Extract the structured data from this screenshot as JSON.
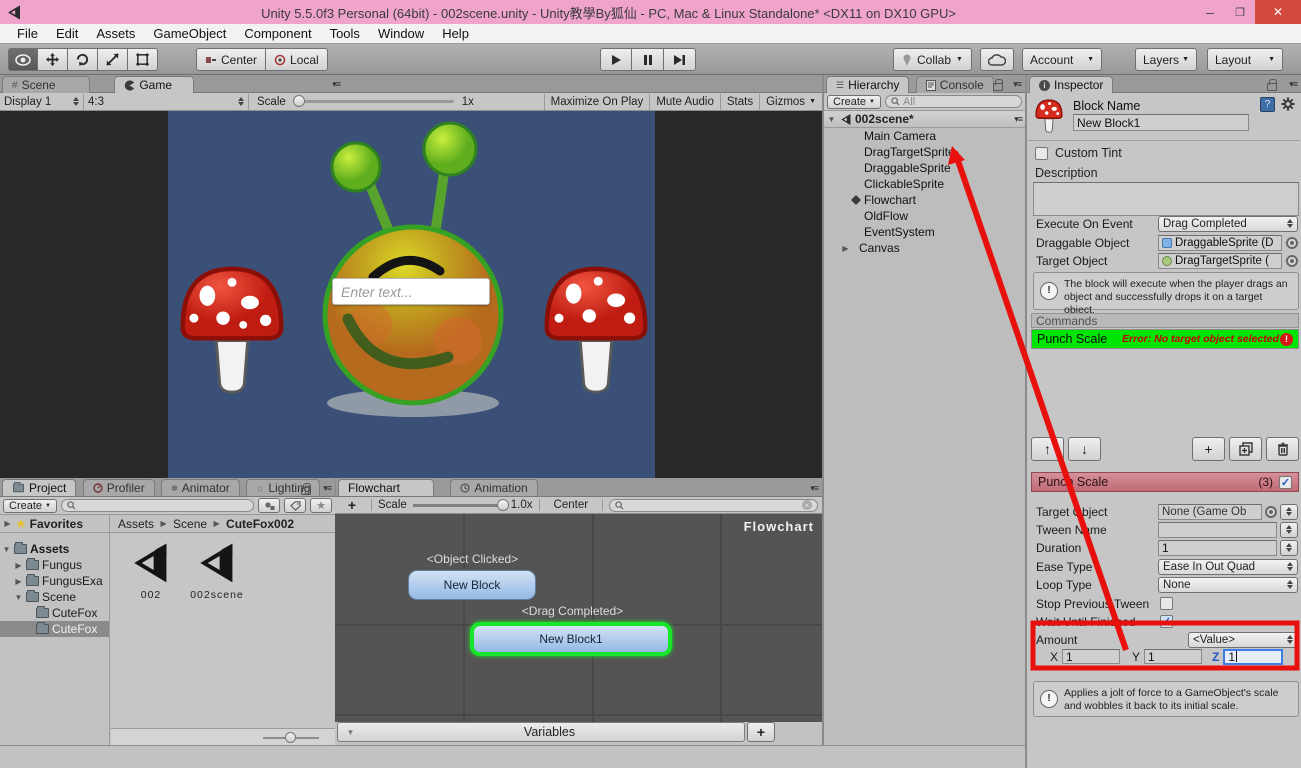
{
  "window": {
    "title": "Unity 5.5.0f3 Personal (64bit) - 002scene.unity - Unity教學By狐仙 - PC, Mac & Linux Standalone* <DX11 on DX10 GPU>",
    "minimize": "–",
    "restore": "❐",
    "close": "✕"
  },
  "menu": {
    "items": [
      "File",
      "Edit",
      "Assets",
      "GameObject",
      "Component",
      "Tools",
      "Window",
      "Help"
    ]
  },
  "toolbar": {
    "center_label": "Center",
    "local_label": "Local",
    "collab_label": "Collab",
    "account_label": "Account",
    "layers_label": "Layers",
    "layout_label": "Layout"
  },
  "game": {
    "scene_tab": "Scene",
    "game_tab": "Game",
    "display": "Display 1",
    "aspect": "4:3",
    "scale_label": "Scale",
    "scale_value": "1x",
    "maximize_label": "Maximize On Play",
    "mute_label": "Mute Audio",
    "stats_label": "Stats",
    "gizmos_label": "Gizmos",
    "input_placeholder": "Enter text...",
    "bg_color": "#3a5076"
  },
  "hierarchy": {
    "tab_label": "Hierarchy",
    "console_label": "Console",
    "create_label": "Create",
    "search_scope": "All",
    "scene_label": "002scene*",
    "items": [
      "Main Camera",
      "DragTargetSprite",
      "DraggableSprite",
      "ClickableSprite",
      "Flowchart",
      "OldFlow",
      "EventSystem",
      "Canvas"
    ]
  },
  "inspector": {
    "tab_label": "Inspector",
    "block_name_label": "Block Name",
    "block_name_value": "New Block1",
    "custom_tint_label": "Custom Tint",
    "custom_tint_checked": false,
    "description_label": "Description",
    "description_value": "",
    "execute_label": "Execute On Event",
    "execute_value": "Drag Completed",
    "draggable_label": "Draggable Object",
    "draggable_value": "DraggableSprite (D",
    "target_label": "Target Object",
    "target_value": "DragTargetSprite (",
    "event_info": "The block will execute when the player drags an object and successfully drops it on a target object."
  },
  "commands": {
    "header": "Commands",
    "name": "Punch Scale",
    "error": "Error: No target object selected",
    "row_color": "#00e504"
  },
  "punch": {
    "title": "Punch Scale",
    "count": "(3)",
    "enabled": true,
    "target_label": "Target Object",
    "target_value": "None (Game Ob",
    "tween_label": "Tween Name",
    "tween_value": "",
    "duration_label": "Duration",
    "duration_value": "1",
    "ease_label": "Ease Type",
    "ease_value": "Ease In Out Quad",
    "loop_label": "Loop Type",
    "loop_value": "None",
    "stop_label": "Stop Previous Tween",
    "stop_checked": false,
    "wait_label": "Wait Until Finished",
    "wait_checked": true,
    "amount_label": "Amount",
    "amount_value": "<Value>",
    "x_label": "X",
    "x_value": "1",
    "y_label": "Y",
    "y_value": "1",
    "z_label": "Z",
    "z_value": "1",
    "info": "Applies a jolt of force to a GameObject's scale and wobbles it back to its initial scale."
  },
  "project": {
    "tab_label": "Project",
    "profiler_label": "Profiler",
    "animator_label": "Animator",
    "lighting_label": "Lighting",
    "create_label": "Create",
    "favorites_label": "Favorites",
    "breadcrumb": [
      "Assets",
      "Scene",
      "CuteFox002"
    ],
    "tree": [
      "Assets",
      "Fungus",
      "FungusExa",
      "Scene",
      "CuteFox",
      "CuteFox"
    ],
    "assets": [
      "002",
      "002scene"
    ]
  },
  "flowchart": {
    "tab_label": "Flowchart",
    "animation_label": "Animation",
    "add_label": "+",
    "scale_label": "Scale",
    "scale_value": "1.0x",
    "center_label": "Center",
    "canvas_label": "Flowchart",
    "node1_event": "<Object Clicked>",
    "node1_name": "New Block",
    "node2_event": "<Drag Completed>",
    "node2_name": "New Block1",
    "variables_label": "Variables",
    "variables_add": "+"
  },
  "colors": {
    "title_pink": "#f0a4cc",
    "annotation_red": "#e8100c",
    "selected_green": "#17e62b",
    "focus_blue": "#3e7de7"
  }
}
